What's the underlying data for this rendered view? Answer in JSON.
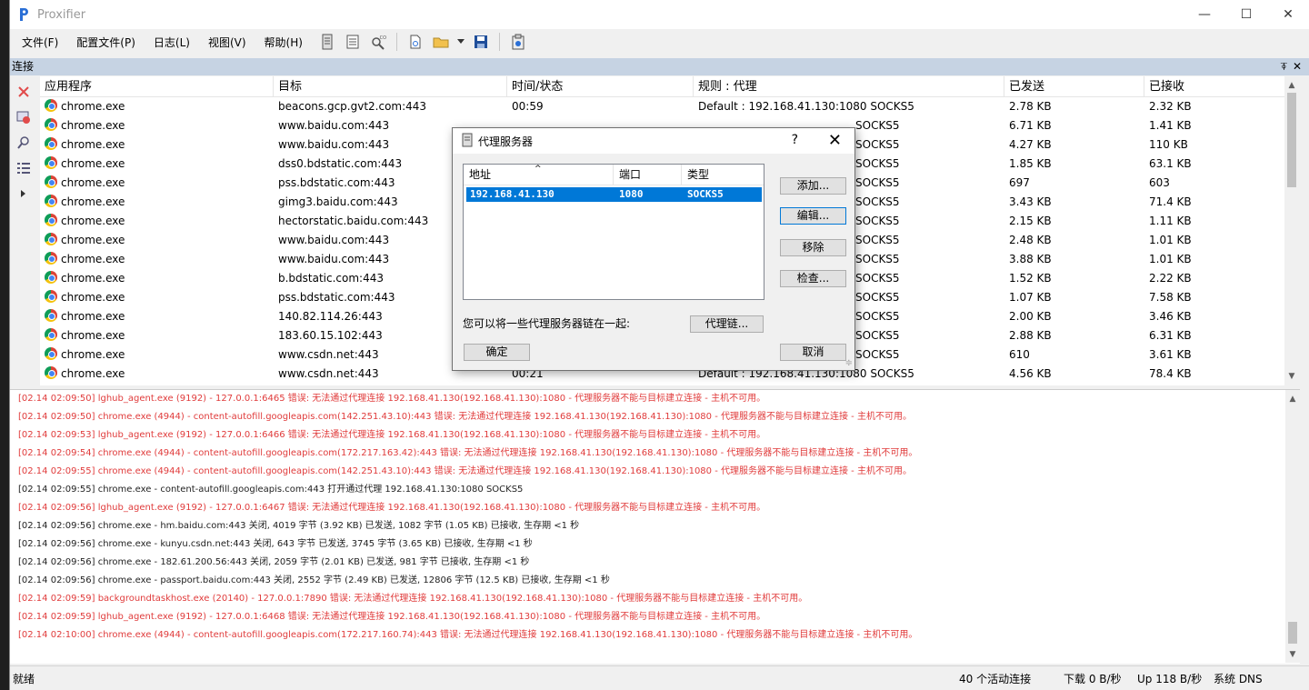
{
  "window": {
    "title": "Proxifier"
  },
  "menu": [
    "文件(F)",
    "配置文件(P)",
    "日志(L)",
    "视图(V)",
    "帮助(H)"
  ],
  "connections_header": "连接",
  "columns": [
    "应用程序",
    "目标",
    "时间/状态",
    "规则 : 代理",
    "已发送",
    "已接收"
  ],
  "rows": [
    {
      "app": "chrome.exe",
      "target": "beacons.gcp.gvt2.com:443",
      "time": "00:59",
      "rule": "Default : 192.168.41.130:1080 SOCKS5",
      "sent": "2.78 KB",
      "recv": "2.32 KB"
    },
    {
      "app": "chrome.exe",
      "target": "www.baidu.com:443",
      "time": "",
      "rule": "SOCKS5",
      "sent": "6.71 KB",
      "recv": "1.41 KB"
    },
    {
      "app": "chrome.exe",
      "target": "www.baidu.com:443",
      "time": "",
      "rule": "SOCKS5",
      "sent": "4.27 KB",
      "recv": "110 KB"
    },
    {
      "app": "chrome.exe",
      "target": "dss0.bdstatic.com:443",
      "time": "",
      "rule": "SOCKS5",
      "sent": "1.85 KB",
      "recv": "63.1 KB"
    },
    {
      "app": "chrome.exe",
      "target": "pss.bdstatic.com:443",
      "time": "",
      "rule": "SOCKS5",
      "sent": "697",
      "recv": "603"
    },
    {
      "app": "chrome.exe",
      "target": "gimg3.baidu.com:443",
      "time": "",
      "rule": "SOCKS5",
      "sent": "3.43 KB",
      "recv": "71.4 KB"
    },
    {
      "app": "chrome.exe",
      "target": "hectorstatic.baidu.com:443",
      "time": "",
      "rule": "SOCKS5",
      "sent": "2.15 KB",
      "recv": "1.11 KB"
    },
    {
      "app": "chrome.exe",
      "target": "www.baidu.com:443",
      "time": "",
      "rule": "SOCKS5",
      "sent": "2.48 KB",
      "recv": "1.01 KB"
    },
    {
      "app": "chrome.exe",
      "target": "www.baidu.com:443",
      "time": "",
      "rule": "SOCKS5",
      "sent": "3.88 KB",
      "recv": "1.01 KB"
    },
    {
      "app": "chrome.exe",
      "target": "b.bdstatic.com:443",
      "time": "",
      "rule": "SOCKS5",
      "sent": "1.52 KB",
      "recv": "2.22 KB"
    },
    {
      "app": "chrome.exe",
      "target": "pss.bdstatic.com:443",
      "time": "",
      "rule": "SOCKS5",
      "sent": "1.07 KB",
      "recv": "7.58 KB"
    },
    {
      "app": "chrome.exe",
      "target": "140.82.114.26:443",
      "time": "",
      "rule": "SOCKS5",
      "sent": "2.00 KB",
      "recv": "3.46 KB"
    },
    {
      "app": "chrome.exe",
      "target": "183.60.15.102:443",
      "time": "",
      "rule": "SOCKS5",
      "sent": "2.88 KB",
      "recv": "6.31 KB"
    },
    {
      "app": "chrome.exe",
      "target": "www.csdn.net:443",
      "time": "",
      "rule": "SOCKS5",
      "sent": "610",
      "recv": "3.61 KB"
    },
    {
      "app": "chrome.exe",
      "target": "www.csdn.net:443",
      "time": "00:21",
      "rule": "Default : 192.168.41.130:1080 SOCKS5",
      "sent": "4.56 KB",
      "recv": "78.4 KB"
    }
  ],
  "log": [
    {
      "t": "err",
      "text": "[02.14 02:09:50] lghub_agent.exe (9192) - 127.0.0.1:6465 错误: 无法通过代理连接 192.168.41.130(192.168.41.130):1080 - 代理服务器不能与目标建立连接 - 主机不可用。"
    },
    {
      "t": "err",
      "text": "[02.14 02:09:50] chrome.exe (4944) - content-autofill.googleapis.com(142.251.43.10):443 错误: 无法通过代理连接 192.168.41.130(192.168.41.130):1080 - 代理服务器不能与目标建立连接 - 主机不可用。"
    },
    {
      "t": "err",
      "text": "[02.14 02:09:53] lghub_agent.exe (9192) - 127.0.0.1:6466 错误: 无法通过代理连接 192.168.41.130(192.168.41.130):1080 - 代理服务器不能与目标建立连接 - 主机不可用。"
    },
    {
      "t": "err",
      "text": "[02.14 02:09:54] chrome.exe (4944) - content-autofill.googleapis.com(172.217.163.42):443 错误: 无法通过代理连接 192.168.41.130(192.168.41.130):1080 - 代理服务器不能与目标建立连接 - 主机不可用。"
    },
    {
      "t": "err",
      "text": "[02.14 02:09:55] chrome.exe (4944) - content-autofill.googleapis.com(142.251.43.10):443 错误: 无法通过代理连接 192.168.41.130(192.168.41.130):1080 - 代理服务器不能与目标建立连接 - 主机不可用。"
    },
    {
      "t": "ok",
      "text": "[02.14 02:09:55] chrome.exe - content-autofill.googleapis.com:443 打开通过代理 192.168.41.130:1080 SOCKS5"
    },
    {
      "t": "err",
      "text": "[02.14 02:09:56] lghub_agent.exe (9192) - 127.0.0.1:6467 错误: 无法通过代理连接 192.168.41.130(192.168.41.130):1080 - 代理服务器不能与目标建立连接 - 主机不可用。"
    },
    {
      "t": "ok",
      "text": "[02.14 02:09:56] chrome.exe - hm.baidu.com:443 关闭, 4019 字节 (3.92 KB) 已发送, 1082 字节 (1.05 KB) 已接收, 生存期 <1 秒"
    },
    {
      "t": "ok",
      "text": "[02.14 02:09:56] chrome.exe - kunyu.csdn.net:443 关闭, 643 字节 已发送, 3745 字节 (3.65 KB) 已接收, 生存期 <1 秒"
    },
    {
      "t": "ok",
      "text": "[02.14 02:09:56] chrome.exe - 182.61.200.56:443 关闭, 2059 字节 (2.01 KB) 已发送, 981 字节 已接收, 生存期 <1 秒"
    },
    {
      "t": "ok",
      "text": "[02.14 02:09:56] chrome.exe - passport.baidu.com:443 关闭, 2552 字节 (2.49 KB) 已发送, 12806 字节 (12.5 KB) 已接收, 生存期 <1 秒"
    },
    {
      "t": "err",
      "text": "[02.14 02:09:59] backgroundtaskhost.exe (20140) - 127.0.0.1:7890 错误: 无法通过代理连接 192.168.41.130(192.168.41.130):1080 - 代理服务器不能与目标建立连接 - 主机不可用。"
    },
    {
      "t": "err",
      "text": "[02.14 02:09:59] lghub_agent.exe (9192) - 127.0.0.1:6468 错误: 无法通过代理连接 192.168.41.130(192.168.41.130):1080 - 代理服务器不能与目标建立连接 - 主机不可用。"
    },
    {
      "t": "err",
      "text": "[02.14 02:10:00] chrome.exe (4944) - content-autofill.googleapis.com(172.217.160.74):443 错误: 无法通过代理连接 192.168.41.130(192.168.41.130):1080 - 代理服务器不能与目标建立连接 - 主机不可用。"
    }
  ],
  "status": {
    "ready": "就绪",
    "active": "40 个活动连接",
    "down": "下载 0 B/秒",
    "up": "Up 118 B/秒",
    "dns": "系统 DNS"
  },
  "dialog": {
    "title": "代理服务器",
    "help": "?",
    "columns": [
      "地址",
      "端口",
      "类型"
    ],
    "row": {
      "address": "192.168.41.130",
      "port": "1080",
      "type": "SOCKS5"
    },
    "buttons": {
      "add": "添加...",
      "edit": "编辑...",
      "remove": "移除",
      "check": "检查...",
      "chain": "代理链...",
      "ok": "确定",
      "cancel": "取消"
    },
    "chain_label": "您可以将一些代理服务器链在一起:"
  },
  "colors": {
    "error": "#e03b3b",
    "selection": "#0078d7",
    "panel_header": "#c6d3e3"
  }
}
